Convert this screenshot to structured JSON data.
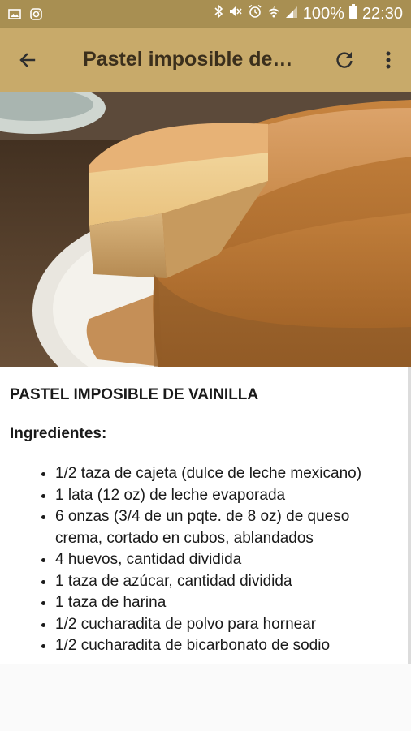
{
  "status_bar": {
    "battery_percent": "100%",
    "time": "22:30",
    "left_icons": [
      "image-icon",
      "instagram-icon"
    ],
    "right_icons": [
      "bluetooth-icon",
      "mute-icon",
      "alarm-icon",
      "wifi-icon",
      "signal-icon",
      "battery-icon"
    ]
  },
  "appbar": {
    "title": "Pastel imposible de…",
    "back_icon": "back-arrow-icon",
    "refresh_icon": "refresh-icon",
    "menu_icon": "more-vert-icon",
    "color": "#c8aa6a"
  },
  "hero_image": {
    "subject": "flan cake slice"
  },
  "recipe": {
    "title": "PASTEL IMPOSIBLE DE VAINILLA",
    "ingredients_heading": "Ingredientes:",
    "ingredients": [
      "1/2 taza de cajeta (dulce de leche mexicano)",
      "1 lata (12 oz) de leche evaporada",
      "6 onzas (3/4 de un pqte. de 8 oz) de queso crema, cortado en cubos, ablandados",
      "4 huevos, cantidad dividida",
      "1 taza de azúcar, cantidad dividida",
      "1 taza de harina",
      "1/2 cucharadita de polvo para hornear",
      "1/2 cucharadita de bicarbonato de sodio"
    ]
  }
}
